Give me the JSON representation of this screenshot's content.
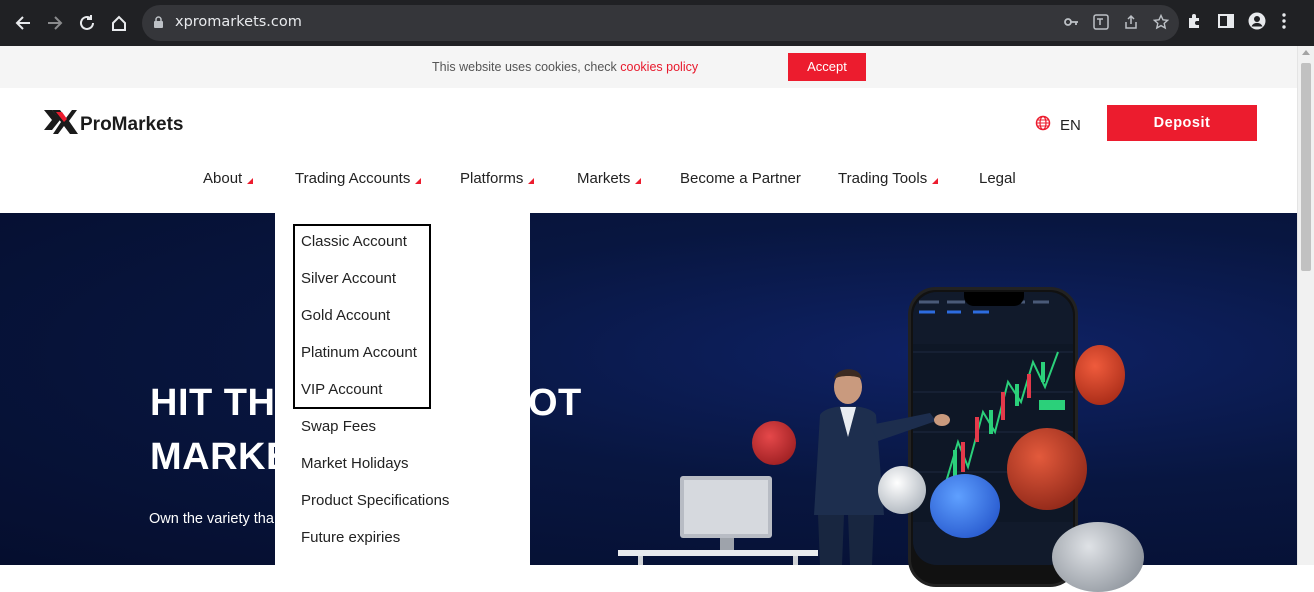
{
  "browser": {
    "url": "xpromarkets.com"
  },
  "cookie_bar": {
    "text": "This website uses cookies, check ",
    "link": "cookies policy",
    "accept_label": "Accept"
  },
  "header": {
    "brand": "ProMarkets",
    "language": "EN",
    "deposit_label": "Deposit"
  },
  "nav": {
    "about": "About",
    "trading_accounts": "Trading Accounts",
    "platforms": "Platforms",
    "markets": "Markets",
    "partner": "Become a Partner",
    "tools": "Trading Tools",
    "legal": "Legal"
  },
  "dropdown": {
    "items": [
      "Classic Account",
      "Silver Account",
      "Gold Account",
      "Platinum Account",
      "VIP Account",
      "Swap Fees",
      "Market Holidays",
      "Product Specifications",
      "Future expiries"
    ]
  },
  "hero": {
    "line1": "HIT TH",
    "line1_end": "OT",
    "line2": "MARKE",
    "subtitle": "Own the variety tha"
  },
  "colors": {
    "accent": "#ec1c2e",
    "chrome": "#202124",
    "hero_bg": "#081640"
  }
}
